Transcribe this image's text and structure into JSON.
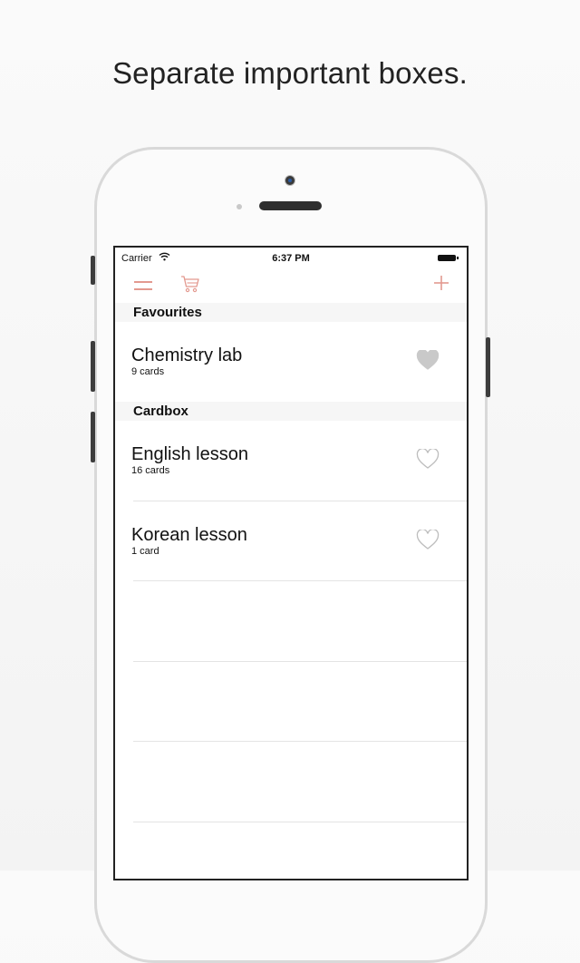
{
  "headline": "Separate important boxes.",
  "status_bar": {
    "carrier": "Carrier",
    "time": "6:37 PM"
  },
  "sections": [
    {
      "title": "Favourites",
      "items": [
        {
          "title": "Chemistry lab",
          "subtitle": "9 cards",
          "favourite": true
        }
      ]
    },
    {
      "title": "Cardbox",
      "items": [
        {
          "title": "English lesson",
          "subtitle": "16 cards",
          "favourite": false
        },
        {
          "title": "Korean lesson",
          "subtitle": "1 card",
          "favourite": false
        }
      ]
    }
  ],
  "colors": {
    "accent": "#e3998f",
    "heart_filled": "#c9c9c9",
    "heart_outline": "#bdbdbd"
  },
  "icons": [
    "menu-icon",
    "cart-icon",
    "plus-icon",
    "heart-icon",
    "heart-outline-icon",
    "wifi-icon",
    "battery-icon"
  ]
}
